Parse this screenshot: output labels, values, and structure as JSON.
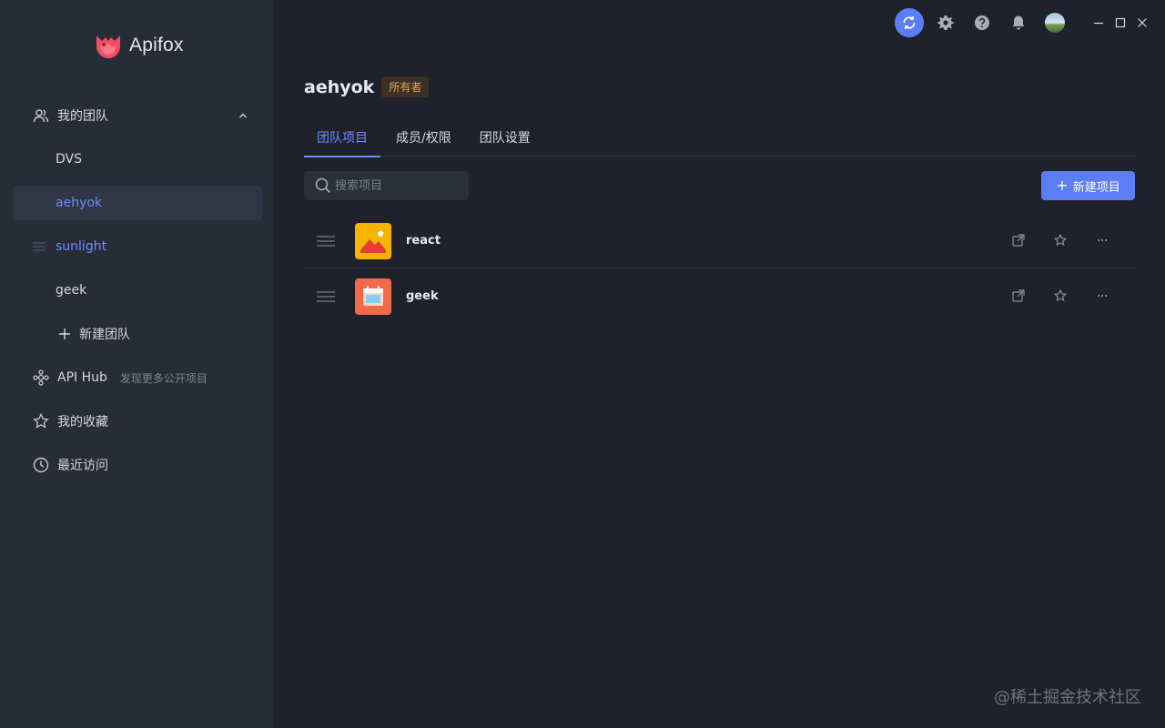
{
  "app": {
    "name": "Apifox"
  },
  "sidebar": {
    "my_team": {
      "label": "我的团队",
      "icon": "users-icon"
    },
    "teams": [
      {
        "label": "DVS"
      },
      {
        "label": "aehyok",
        "active": true
      },
      {
        "label": "sunlight"
      },
      {
        "label": "geek"
      }
    ],
    "new_team": {
      "label": "新建团队"
    },
    "api_hub": {
      "label": "API Hub",
      "sub": "发现更多公开项目"
    },
    "favorites": {
      "label": "我的收藏"
    },
    "recent": {
      "label": "最近访问"
    }
  },
  "header": {
    "team_name": "aehyok",
    "role_badge": "所有者"
  },
  "tabs": [
    {
      "label": "团队项目",
      "active": true
    },
    {
      "label": "成员/权限"
    },
    {
      "label": "团队设置"
    }
  ],
  "search": {
    "placeholder": "搜索项目",
    "value": ""
  },
  "new_project_button": {
    "label": "新建项目"
  },
  "projects": [
    {
      "name": "react",
      "icon": "mountain-sunset-icon"
    },
    {
      "name": "geek",
      "icon": "calendar-icon"
    }
  ],
  "watermark": "@稀土掘金技术社区",
  "colors": {
    "accent": "#5b7df5",
    "active_text": "#6d8cff",
    "badge_text": "#e8a45b",
    "sidebar_bg": "#282c36",
    "main_bg": "#1f222b"
  }
}
